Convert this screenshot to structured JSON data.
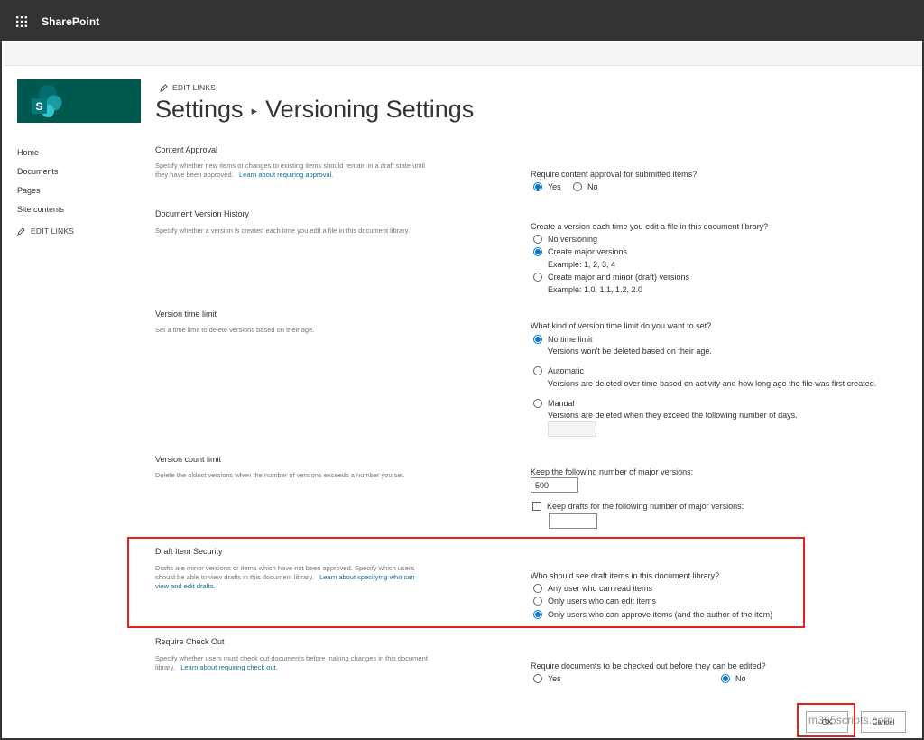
{
  "app": {
    "name": "SharePoint"
  },
  "nav": {
    "edit_links_label": "EDIT LINKS",
    "items": [
      {
        "label": "Home"
      },
      {
        "label": "Documents"
      },
      {
        "label": "Pages"
      },
      {
        "label": "Site contents"
      }
    ]
  },
  "header": {
    "edit_links_label": "EDIT LINKS",
    "breadcrumb_root": "Settings",
    "breadcrumb_separator": "▸",
    "page_title": "Versioning Settings"
  },
  "sections": {
    "content_approval": {
      "title": "Content Approval",
      "desc_line1": "Specify whether new items or changes to existing items should remain in a draft state until",
      "desc_line2": "they have been approved.",
      "link": "Learn about requiring approval.",
      "question": "Require content approval for submitted items?",
      "options": [
        "Yes",
        "No"
      ],
      "selected": "Yes"
    },
    "version_history": {
      "title": "Document Version History",
      "desc": "Specify whether a version is created each time you edit a file in this document library.",
      "question": "Create a version each time you edit a file in this document library?",
      "options": [
        "No versioning",
        "Create major versions",
        "Create major and minor (draft) versions"
      ],
      "examples": [
        "Example: 1, 2, 3, 4",
        "Example: 1.0, 1.1, 1.2, 2.0"
      ],
      "selected": "Create major versions"
    },
    "time_limit": {
      "title": "Version time limit",
      "desc": "Set a time limit to delete versions based on their age.",
      "question": "What kind of version time limit do you want to set?",
      "options": [
        "No time limit",
        "Automatic",
        "Manual"
      ],
      "option_descs": [
        "Versions won't be deleted based on their age.",
        "Versions are deleted over time based on activity and how long ago the file was first created.",
        "Versions are deleted when they exceed the following number of days."
      ],
      "selected": "No time limit",
      "days_value": ""
    },
    "count_limit": {
      "title": "Version count limit",
      "desc": "Delete the oldest versions when the number of versions exceeds a number you set.",
      "question": "Keep the following number of major versions:",
      "major_value": "500",
      "drafts_label": "Keep drafts for the following number of major versions:",
      "drafts_checked": false,
      "drafts_value": ""
    },
    "draft_security": {
      "title": "Draft Item Security",
      "desc_line1": "Drafts are minor versions or items which have not been approved. Specify which users",
      "desc_line2": "should be able to view drafts in this document library.",
      "link_part1": "Learn about specifying who can",
      "link_part2": "view and edit drafts.",
      "question": "Who should see draft items in this document library?",
      "options": [
        "Any user who can read items",
        "Only users who can edit items",
        "Only users who can approve items (and the author of the item)"
      ],
      "selected": "Only users who can approve items (and the author of the item)"
    },
    "check_out": {
      "title": "Require Check Out",
      "desc_line1": "Specify whether users must check out documents before making changes in this document",
      "desc_line2": "library.",
      "link": "Learn about requiring check out.",
      "question": "Require documents to be checked out before they can be edited?",
      "options": [
        "Yes",
        "No"
      ],
      "selected": "No"
    }
  },
  "buttons": {
    "ok": "OK",
    "cancel": "Cancel"
  },
  "watermark": "m365scripts.com",
  "colors": {
    "suitebar": "#333333",
    "logo": "#00594f",
    "accent": "#0078d4",
    "highlight": "#e2231a",
    "link": "#0f6f8f"
  }
}
